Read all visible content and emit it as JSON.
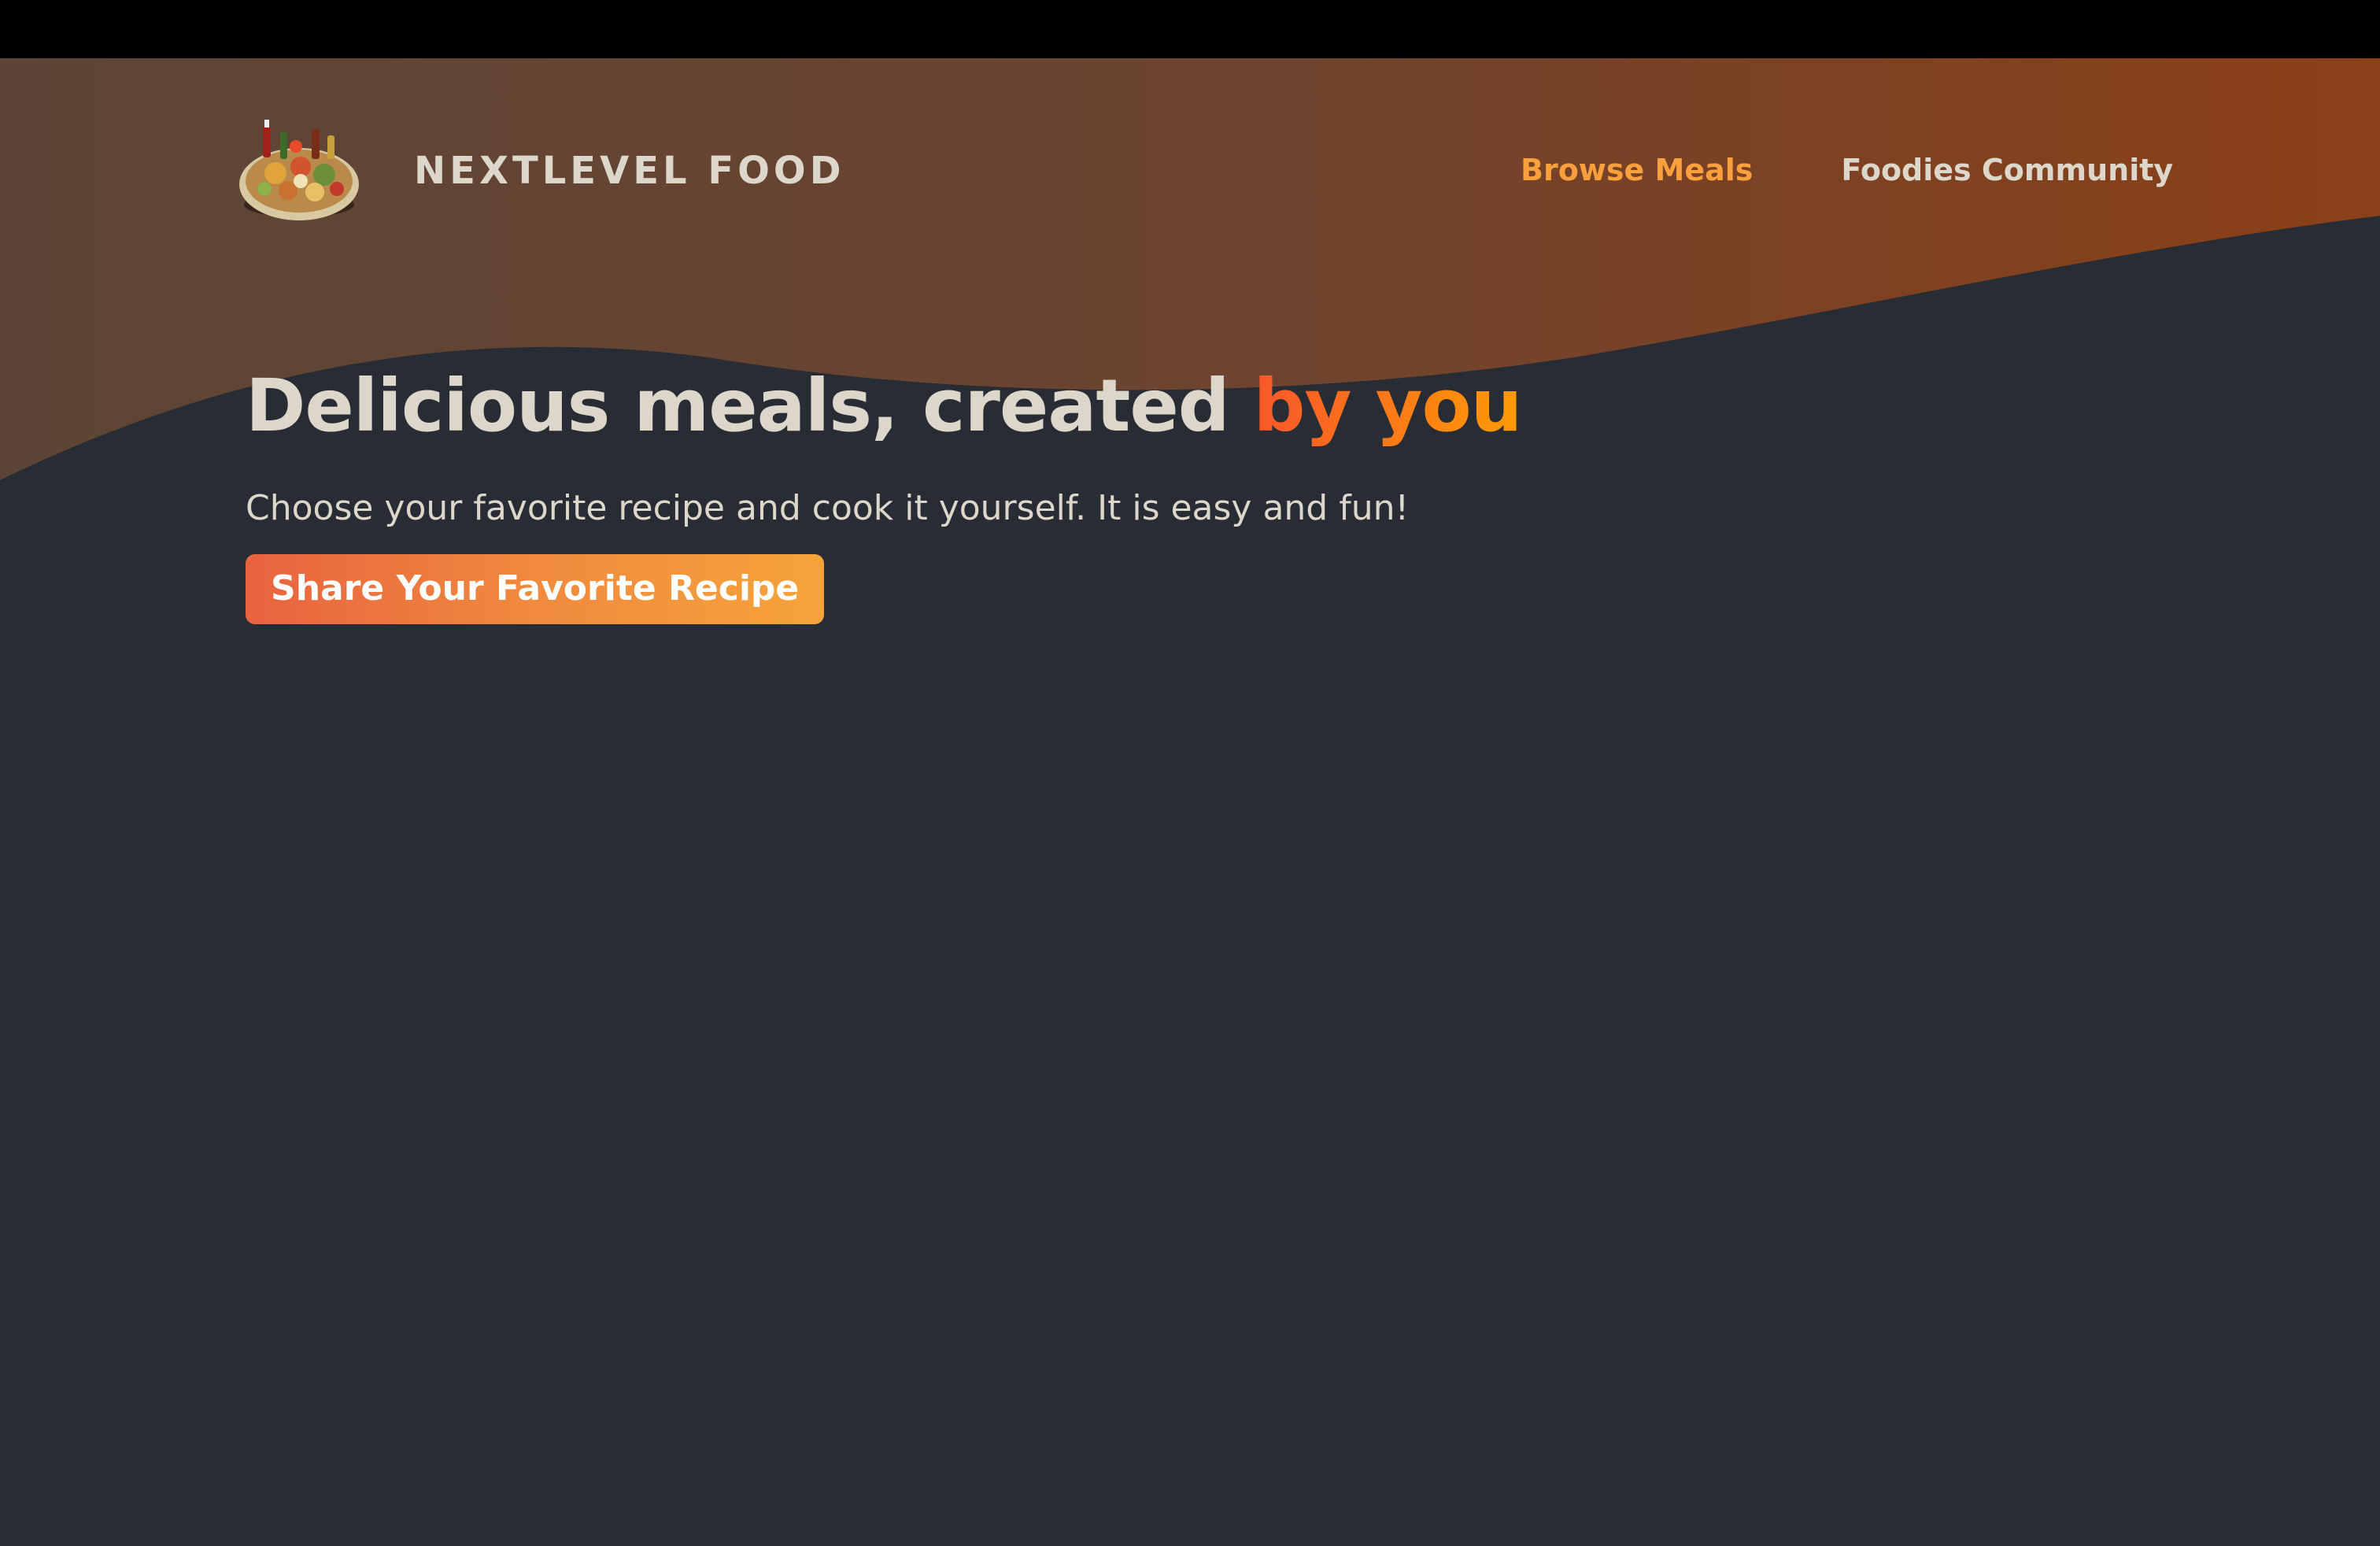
{
  "header": {
    "logo_text": "NEXTLEVEL FOOD",
    "logo_alt": "A plate with food on it",
    "nav": {
      "browse_meals": "Browse Meals",
      "foodies_community": "Foodies Community"
    }
  },
  "hero": {
    "title_main": "Delicious meals, created ",
    "title_accent": "by you",
    "subtitle": "Choose your favorite recipe and cook it yourself. It is easy and fun!",
    "cta_label": "Share Your Favorite Recipe"
  },
  "colors": {
    "page_background": "#282c34",
    "top_bar": "#000000",
    "wave_start": "#5a4539",
    "wave_end": "#8a3f17",
    "text_light": "#ddd6cb",
    "accent_orange": "#f9a03c",
    "accent_gradient_start": "#e8633f",
    "accent_gradient_end": "#f6a33a"
  }
}
